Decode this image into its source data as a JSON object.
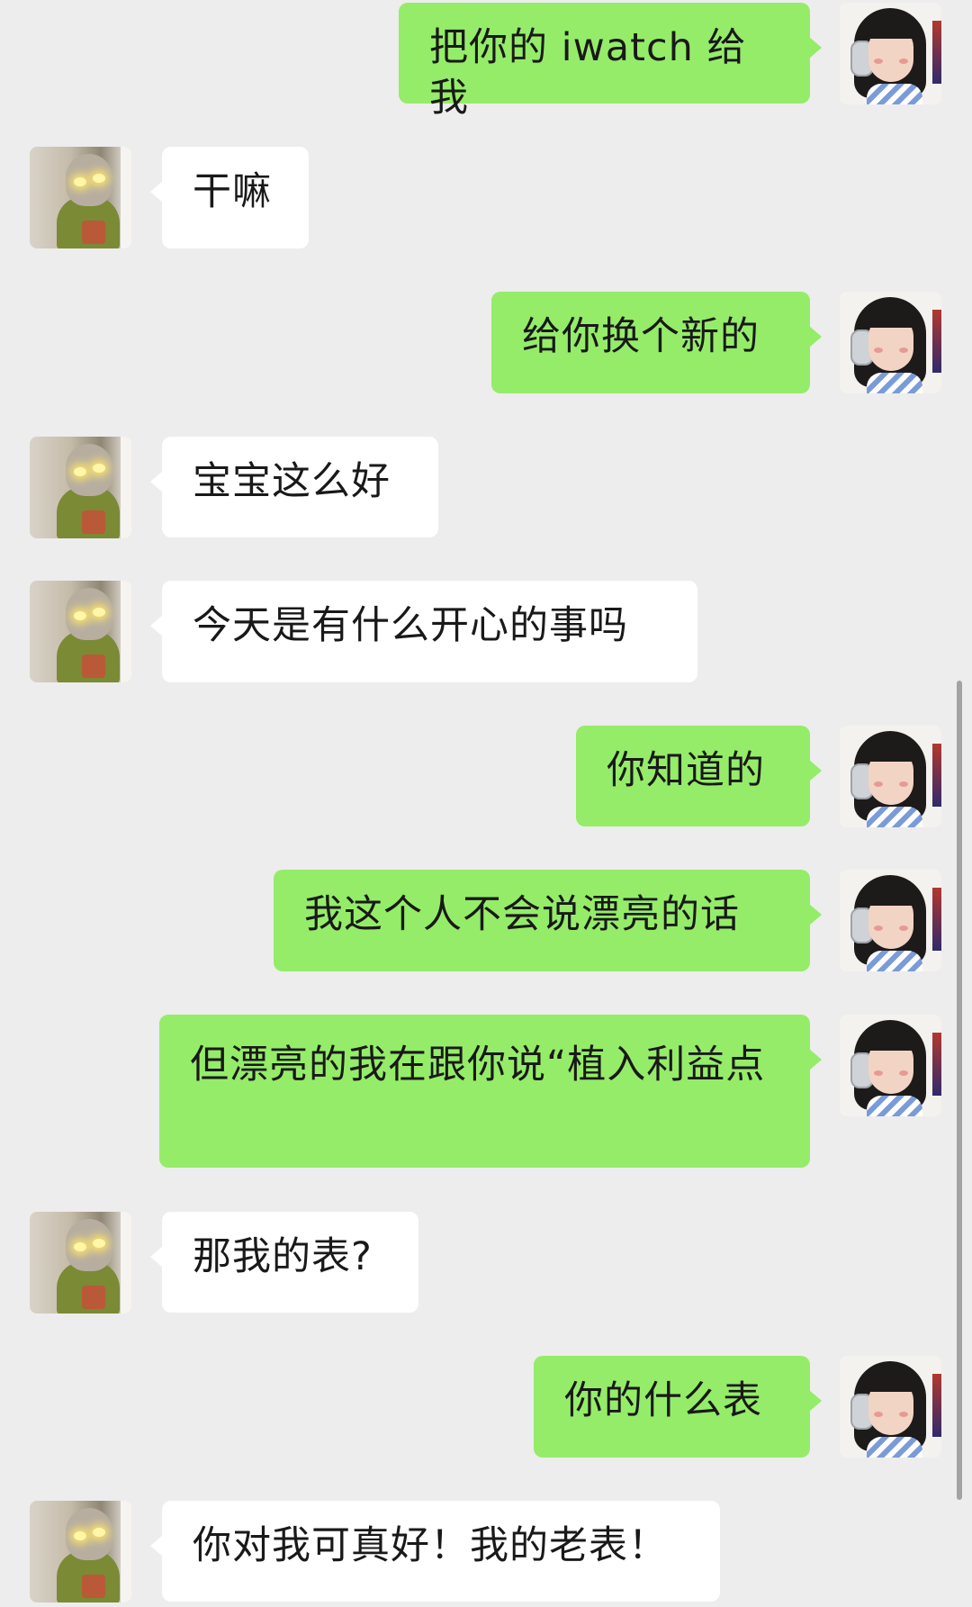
{
  "chat": {
    "messages": [
      {
        "from": "me",
        "text": "把你的 iwatch 给我"
      },
      {
        "from": "other",
        "text": "干嘛"
      },
      {
        "from": "me",
        "text": "给你换个新的"
      },
      {
        "from": "other",
        "text": "宝宝这么好"
      },
      {
        "from": "other",
        "text": "今天是有什么开心的事吗"
      },
      {
        "from": "me",
        "text": "你知道的"
      },
      {
        "from": "me",
        "text": "我这个人不会说漂亮的话"
      },
      {
        "from": "me",
        "text": "但漂亮的我在跟你说“植入利益点"
      },
      {
        "from": "other",
        "text": "那我的表?"
      },
      {
        "from": "me",
        "text": "你的什么表"
      },
      {
        "from": "other",
        "text": "你对我可真好！我的老表！"
      }
    ]
  },
  "colors": {
    "background": "#ededed",
    "sent_bubble": "#95ec69",
    "received_bubble": "#ffffff",
    "text": "#191919"
  },
  "icons": {
    "sender_avatar": "avatar-me-icon",
    "receiver_avatar": "avatar-friend-icon"
  }
}
